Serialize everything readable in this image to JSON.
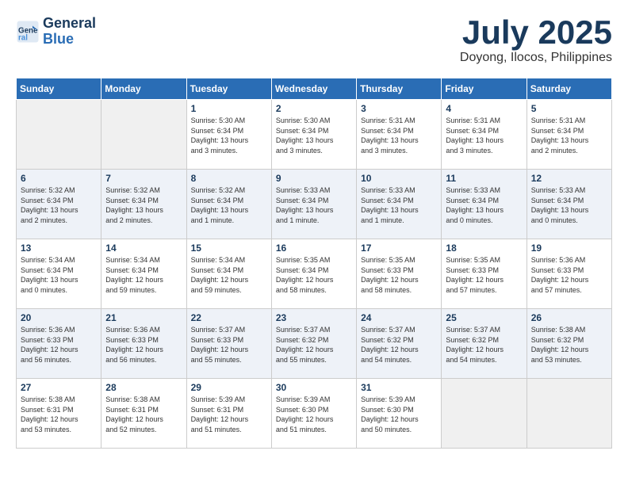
{
  "header": {
    "logo_line1": "General",
    "logo_line2": "Blue",
    "month_title": "July 2025",
    "location": "Doyong, Ilocos, Philippines"
  },
  "weekdays": [
    "Sunday",
    "Monday",
    "Tuesday",
    "Wednesday",
    "Thursday",
    "Friday",
    "Saturday"
  ],
  "weeks": [
    [
      {
        "day": "",
        "text": ""
      },
      {
        "day": "",
        "text": ""
      },
      {
        "day": "1",
        "text": "Sunrise: 5:30 AM\nSunset: 6:34 PM\nDaylight: 13 hours\nand 3 minutes."
      },
      {
        "day": "2",
        "text": "Sunrise: 5:30 AM\nSunset: 6:34 PM\nDaylight: 13 hours\nand 3 minutes."
      },
      {
        "day": "3",
        "text": "Sunrise: 5:31 AM\nSunset: 6:34 PM\nDaylight: 13 hours\nand 3 minutes."
      },
      {
        "day": "4",
        "text": "Sunrise: 5:31 AM\nSunset: 6:34 PM\nDaylight: 13 hours\nand 3 minutes."
      },
      {
        "day": "5",
        "text": "Sunrise: 5:31 AM\nSunset: 6:34 PM\nDaylight: 13 hours\nand 2 minutes."
      }
    ],
    [
      {
        "day": "6",
        "text": "Sunrise: 5:32 AM\nSunset: 6:34 PM\nDaylight: 13 hours\nand 2 minutes."
      },
      {
        "day": "7",
        "text": "Sunrise: 5:32 AM\nSunset: 6:34 PM\nDaylight: 13 hours\nand 2 minutes."
      },
      {
        "day": "8",
        "text": "Sunrise: 5:32 AM\nSunset: 6:34 PM\nDaylight: 13 hours\nand 1 minute."
      },
      {
        "day": "9",
        "text": "Sunrise: 5:33 AM\nSunset: 6:34 PM\nDaylight: 13 hours\nand 1 minute."
      },
      {
        "day": "10",
        "text": "Sunrise: 5:33 AM\nSunset: 6:34 PM\nDaylight: 13 hours\nand 1 minute."
      },
      {
        "day": "11",
        "text": "Sunrise: 5:33 AM\nSunset: 6:34 PM\nDaylight: 13 hours\nand 0 minutes."
      },
      {
        "day": "12",
        "text": "Sunrise: 5:33 AM\nSunset: 6:34 PM\nDaylight: 13 hours\nand 0 minutes."
      }
    ],
    [
      {
        "day": "13",
        "text": "Sunrise: 5:34 AM\nSunset: 6:34 PM\nDaylight: 13 hours\nand 0 minutes."
      },
      {
        "day": "14",
        "text": "Sunrise: 5:34 AM\nSunset: 6:34 PM\nDaylight: 12 hours\nand 59 minutes."
      },
      {
        "day": "15",
        "text": "Sunrise: 5:34 AM\nSunset: 6:34 PM\nDaylight: 12 hours\nand 59 minutes."
      },
      {
        "day": "16",
        "text": "Sunrise: 5:35 AM\nSunset: 6:34 PM\nDaylight: 12 hours\nand 58 minutes."
      },
      {
        "day": "17",
        "text": "Sunrise: 5:35 AM\nSunset: 6:33 PM\nDaylight: 12 hours\nand 58 minutes."
      },
      {
        "day": "18",
        "text": "Sunrise: 5:35 AM\nSunset: 6:33 PM\nDaylight: 12 hours\nand 57 minutes."
      },
      {
        "day": "19",
        "text": "Sunrise: 5:36 AM\nSunset: 6:33 PM\nDaylight: 12 hours\nand 57 minutes."
      }
    ],
    [
      {
        "day": "20",
        "text": "Sunrise: 5:36 AM\nSunset: 6:33 PM\nDaylight: 12 hours\nand 56 minutes."
      },
      {
        "day": "21",
        "text": "Sunrise: 5:36 AM\nSunset: 6:33 PM\nDaylight: 12 hours\nand 56 minutes."
      },
      {
        "day": "22",
        "text": "Sunrise: 5:37 AM\nSunset: 6:33 PM\nDaylight: 12 hours\nand 55 minutes."
      },
      {
        "day": "23",
        "text": "Sunrise: 5:37 AM\nSunset: 6:32 PM\nDaylight: 12 hours\nand 55 minutes."
      },
      {
        "day": "24",
        "text": "Sunrise: 5:37 AM\nSunset: 6:32 PM\nDaylight: 12 hours\nand 54 minutes."
      },
      {
        "day": "25",
        "text": "Sunrise: 5:37 AM\nSunset: 6:32 PM\nDaylight: 12 hours\nand 54 minutes."
      },
      {
        "day": "26",
        "text": "Sunrise: 5:38 AM\nSunset: 6:32 PM\nDaylight: 12 hours\nand 53 minutes."
      }
    ],
    [
      {
        "day": "27",
        "text": "Sunrise: 5:38 AM\nSunset: 6:31 PM\nDaylight: 12 hours\nand 53 minutes."
      },
      {
        "day": "28",
        "text": "Sunrise: 5:38 AM\nSunset: 6:31 PM\nDaylight: 12 hours\nand 52 minutes."
      },
      {
        "day": "29",
        "text": "Sunrise: 5:39 AM\nSunset: 6:31 PM\nDaylight: 12 hours\nand 51 minutes."
      },
      {
        "day": "30",
        "text": "Sunrise: 5:39 AM\nSunset: 6:30 PM\nDaylight: 12 hours\nand 51 minutes."
      },
      {
        "day": "31",
        "text": "Sunrise: 5:39 AM\nSunset: 6:30 PM\nDaylight: 12 hours\nand 50 minutes."
      },
      {
        "day": "",
        "text": ""
      },
      {
        "day": "",
        "text": ""
      }
    ]
  ]
}
